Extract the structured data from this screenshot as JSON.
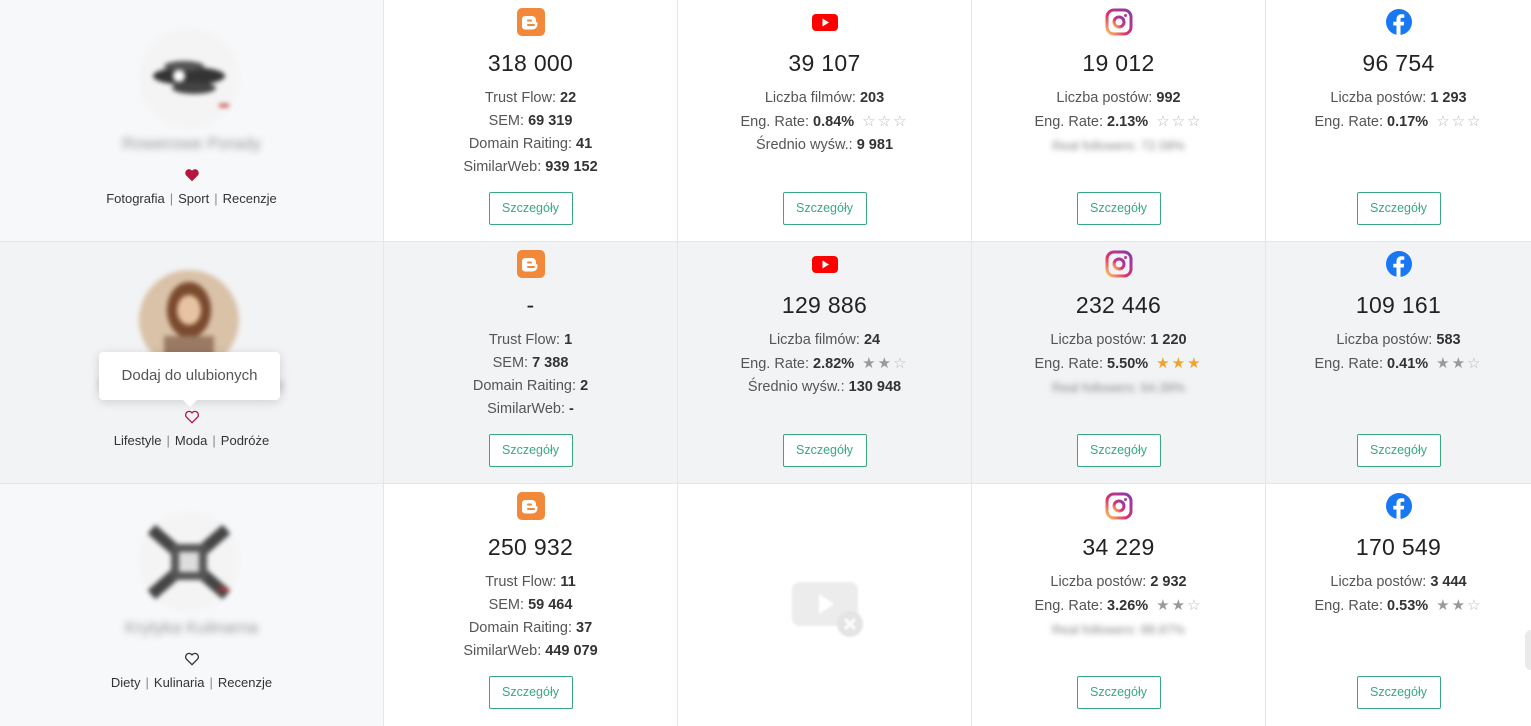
{
  "rows": [
    {
      "profile": {
        "name": "Rowerowe Porady",
        "categories": [
          "Fotografia",
          "Sport",
          "Recenzje"
        ],
        "favorite": true
      },
      "blog": {
        "value": "318 000",
        "trust_flow_label": "Trust Flow:",
        "trust_flow": "22",
        "sem_label": "SEM:",
        "sem": "69 319",
        "dr_label": "Domain Raiting:",
        "dr": "41",
        "sw_label": "SimilarWeb:",
        "sw": "939 152",
        "button": "Szczegóły"
      },
      "youtube": {
        "value": "39 107",
        "films_label": "Liczba filmów:",
        "films": "203",
        "eng_label": "Eng. Rate:",
        "eng": "0.84%",
        "stars": 0,
        "avg_label": "Średnio wyśw.:",
        "avg": "9 981",
        "button": "Szczegóły"
      },
      "instagram": {
        "value": "19 012",
        "posts_label": "Liczba postów:",
        "posts": "992",
        "eng_label": "Eng. Rate:",
        "eng": "2.13%",
        "stars": 0,
        "real_label": "Real followers:",
        "real": "72.58%",
        "button": "Szczegóły"
      },
      "facebook": {
        "value": "96 754",
        "posts_label": "Liczba postów:",
        "posts": "1 293",
        "eng_label": "Eng. Rate:",
        "eng": "0.17%",
        "stars": 0,
        "button": "Szczegóły"
      }
    },
    {
      "profile": {
        "name": "Wiktoria Nowak Lifestyle",
        "categories": [
          "Lifestyle",
          "Moda",
          "Podróże"
        ],
        "favorite": false,
        "tooltip": "Dodaj do ulubionych"
      },
      "blog": {
        "value": "-",
        "trust_flow_label": "Trust Flow:",
        "trust_flow": "1",
        "sem_label": "SEM:",
        "sem": "7 388",
        "dr_label": "Domain Raiting:",
        "dr": "2",
        "sw_label": "SimilarWeb:",
        "sw": "-",
        "button": "Szczegóły"
      },
      "youtube": {
        "value": "129 886",
        "films_label": "Liczba filmów:",
        "films": "24",
        "eng_label": "Eng. Rate:",
        "eng": "2.82%",
        "stars": 2,
        "avg_label": "Średnio wyśw.:",
        "avg": "130 948",
        "button": "Szczegóły"
      },
      "instagram": {
        "value": "232 446",
        "posts_label": "Liczba postów:",
        "posts": "1 220",
        "eng_label": "Eng. Rate:",
        "eng": "5.50%",
        "stars": 3,
        "real_label": "Real followers:",
        "real": "64.39%",
        "button": "Szczegóły"
      },
      "facebook": {
        "value": "109 161",
        "posts_label": "Liczba postów:",
        "posts": "583",
        "eng_label": "Eng. Rate:",
        "eng": "0.41%",
        "stars": 2,
        "button": "Szczegóły"
      }
    },
    {
      "profile": {
        "name": "Krytyka Kulinarna",
        "categories": [
          "Diety",
          "Kulinaria",
          "Recenzje"
        ],
        "favorite": false
      },
      "blog": {
        "value": "250 932",
        "trust_flow_label": "Trust Flow:",
        "trust_flow": "11",
        "sem_label": "SEM:",
        "sem": "59 464",
        "dr_label": "Domain Raiting:",
        "dr": "37",
        "sw_label": "SimilarWeb:",
        "sw": "449 079",
        "button": "Szczegóły"
      },
      "youtube": null,
      "instagram": {
        "value": "34 229",
        "posts_label": "Liczba postów:",
        "posts": "2 932",
        "eng_label": "Eng. Rate:",
        "eng": "3.26%",
        "stars": 2,
        "real_label": "Real followers:",
        "real": "88.87%",
        "button": "Szczegóły"
      },
      "facebook": {
        "value": "170 549",
        "posts_label": "Liczba postów:",
        "posts": "3 444",
        "eng_label": "Eng. Rate:",
        "eng": "0.53%",
        "stars": 2,
        "button": "Szczegóły"
      }
    }
  ],
  "icons": {
    "blog": "blogger-icon",
    "youtube": "youtube-icon",
    "instagram": "instagram-icon",
    "facebook": "facebook-icon",
    "heart": "heart-icon",
    "no_video": "no-video-icon"
  },
  "colors": {
    "accent_green": "#3aa87f",
    "star_gold": "#f0a32c",
    "heart_red": "#b5163d",
    "blogger_orange": "#f1883a",
    "youtube_red": "#ff0000",
    "facebook_blue": "#1877f2"
  }
}
